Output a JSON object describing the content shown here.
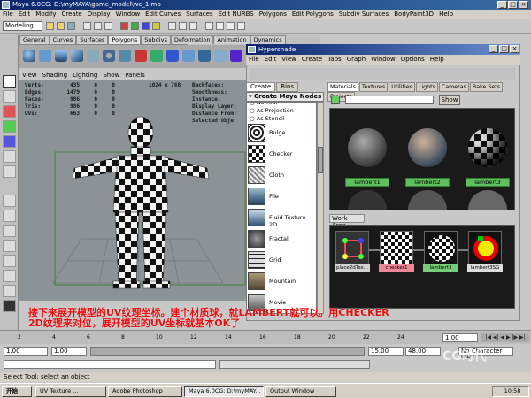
{
  "window": {
    "title": "Maya 6.0CG: D:\\myMAYA\\game_model\\wc_1.mb"
  },
  "menubar": [
    "File",
    "Edit",
    "Modify",
    "Create",
    "Display",
    "Window",
    "Edit Curves",
    "Surfaces",
    "Edit NURBS",
    "Polygons",
    "Edit Polygons",
    "Subdiv Surfaces",
    "BodyPaint3D",
    "Help"
  ],
  "statusline": {
    "mode": "Modeling"
  },
  "shelf": {
    "tabs": [
      "General",
      "Curves",
      "Surfaces",
      "Polygons",
      "Subdivs",
      "Deformation",
      "Animation",
      "Dynamics",
      "Rendering",
      "PaintEffects",
      "Cloth",
      "Fluids",
      "Fur",
      "Custom"
    ],
    "active": "Polygons"
  },
  "viewport": {
    "menu": [
      "View",
      "Shading",
      "Lighting",
      "Show",
      "Panels"
    ],
    "resolution": "1024 x 768",
    "hud_left": [
      {
        "label": "Verts:",
        "v1": "435",
        "v2": "0",
        "v3": "0"
      },
      {
        "label": "Edges:",
        "v1": "1479",
        "v2": "0",
        "v3": "0"
      },
      {
        "label": "Faces:",
        "v1": "986",
        "v2": "0",
        "v3": "0"
      },
      {
        "label": "Tris:",
        "v1": "986",
        "v2": "0",
        "v3": "0"
      },
      {
        "label": "UVs:",
        "v1": "663",
        "v2": "0",
        "v3": "0"
      }
    ],
    "hud_right": [
      "Backfaces:",
      "Smoothness:",
      "Instance:",
      "Display Layer:",
      "Distance From:",
      "Selected Obje"
    ]
  },
  "hypershade": {
    "title": "Hypershade",
    "menu": [
      "File",
      "Edit",
      "View",
      "Create",
      "Tabs",
      "Graph",
      "Window",
      "Options",
      "Help"
    ],
    "left_tabs": [
      "Create",
      "Bins"
    ],
    "create_header": "Create Maya Nodes",
    "radio": [
      "Normal",
      "As Projection",
      "As Stencil"
    ],
    "nodes": [
      "Bulge",
      "Checker",
      "Cloth",
      "File",
      "Fluid Texture 2D",
      "Fractal",
      "Grid",
      "Mountain",
      "Movie",
      "Noise"
    ],
    "tabs": [
      "Materials",
      "Textures",
      "Utilities",
      "Lights",
      "Cameras",
      "Bake Sets",
      "Projects"
    ],
    "show_button": "Show",
    "materials": [
      "lambert1",
      "lambert2",
      "lambert3"
    ],
    "work_area_tab": "Work Area",
    "work_nodes": [
      "place2dTex...",
      "checker1",
      "lambert3",
      "lambert3SG"
    ]
  },
  "overlay_text": "接下来展开模型的UV纹理坐标。建个材质球，就LAMBERT就可以。用CHECKER 2D纹理来对位，展开模型的UV坐标就基本OK了",
  "time": {
    "ticks": [
      "2",
      "4",
      "6",
      "8",
      "10",
      "12",
      "14",
      "16",
      "18",
      "20",
      "22",
      "24"
    ],
    "start": "1.00",
    "end": "1.00",
    "range_end": "15.00",
    "anim_end": "48.00",
    "current": "1.00",
    "character_set": "No Character Set",
    "layer": "Load Attributes"
  },
  "helpline": "Select Tool: select an object",
  "taskbar": {
    "start": "开始",
    "tasks": [
      "UV Texture ...",
      "Adobe Photoshop",
      "Maya 6.0CG: D:\\myMAY...",
      "Output Window"
    ],
    "clock": "10:58"
  },
  "watermark": "CG时代"
}
